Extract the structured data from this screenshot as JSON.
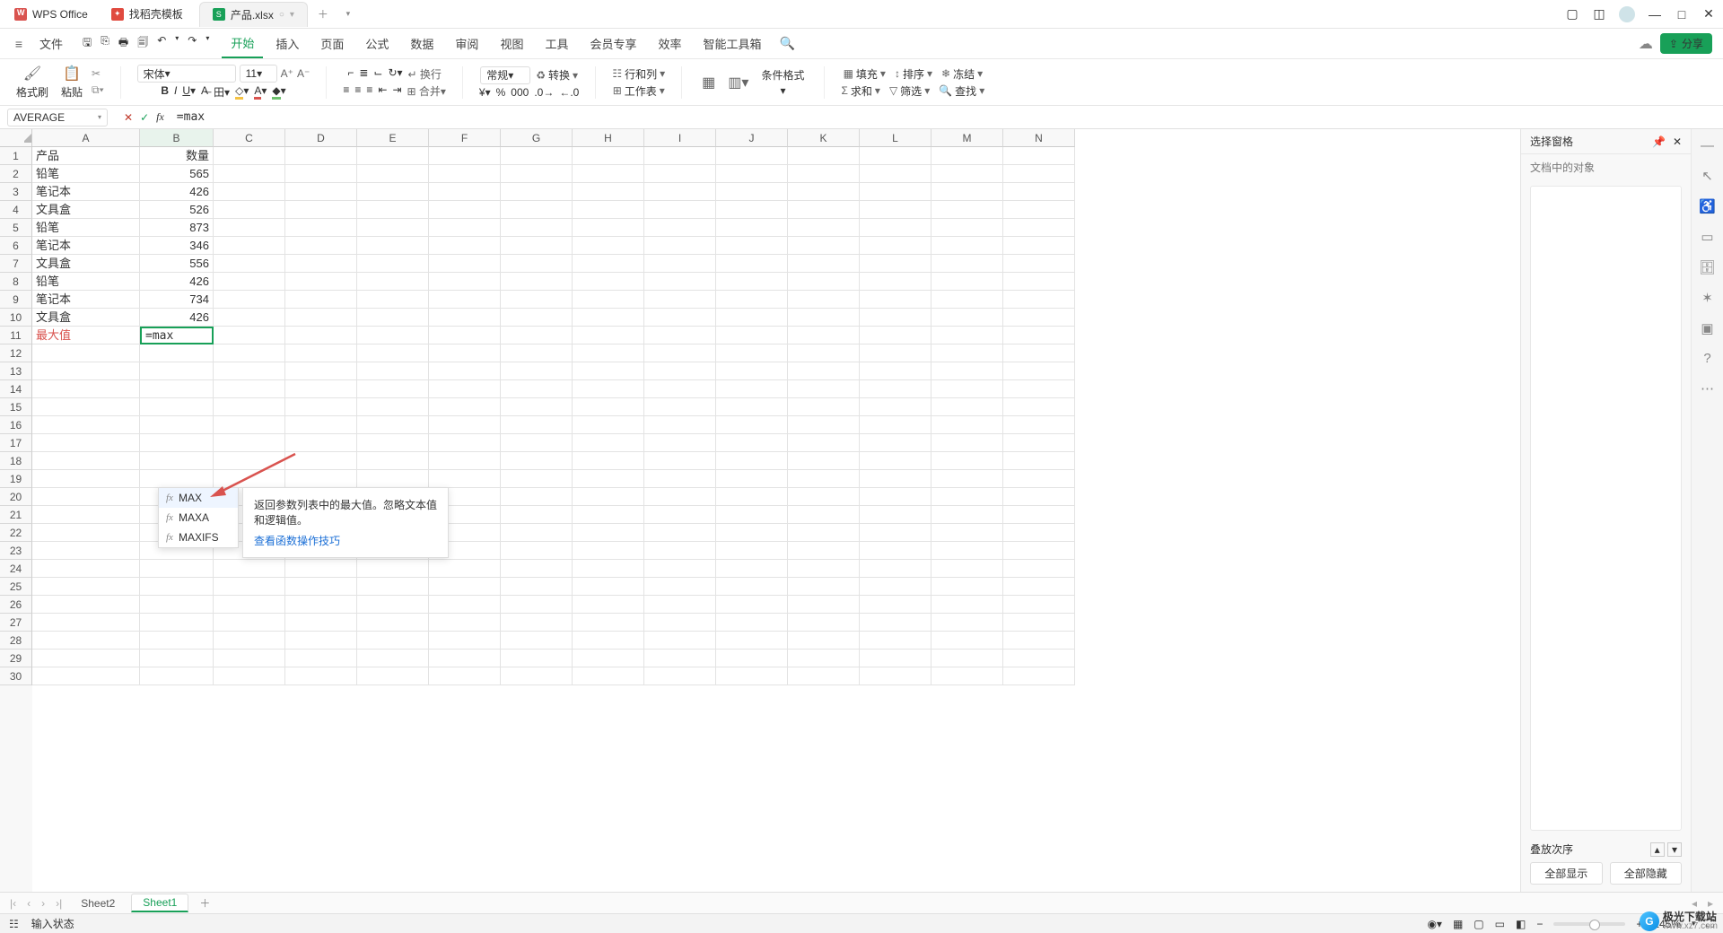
{
  "titlebar": {
    "app_name": "WPS Office",
    "tabs": [
      {
        "icon": "red",
        "label": "找稻壳模板"
      },
      {
        "icon": "green",
        "label": "产品.xlsx",
        "active": true
      }
    ]
  },
  "file_menu": "文件",
  "menu": {
    "items": [
      "开始",
      "插入",
      "页面",
      "公式",
      "数据",
      "审阅",
      "视图",
      "工具",
      "会员专享",
      "效率",
      "智能工具箱"
    ],
    "active": "开始",
    "share": "分享"
  },
  "ribbon": {
    "format_brush": "格式刷",
    "paste": "粘贴",
    "font_name": "宋体",
    "font_size": "11",
    "number_format": "常规",
    "convert": "转换",
    "rowcol": "行和列",
    "worksheet": "工作表",
    "cond_format": "条件格式",
    "fill": "填充",
    "sort": "排序",
    "freeze": "冻结",
    "sum": "求和",
    "filter": "筛选",
    "find": "查找"
  },
  "formula": {
    "namebox": "AVERAGE",
    "value": "=max"
  },
  "columns": [
    "A",
    "B",
    "C",
    "D",
    "E",
    "F",
    "G",
    "H",
    "I",
    "J",
    "K",
    "L",
    "M",
    "N"
  ],
  "sheet_data": {
    "header": {
      "a": "产品",
      "b": "数量"
    },
    "rows": [
      {
        "a": "铅笔",
        "b": "565"
      },
      {
        "a": "笔记本",
        "b": "426"
      },
      {
        "a": "文具盒",
        "b": "526"
      },
      {
        "a": "铅笔",
        "b": "873"
      },
      {
        "a": "笔记本",
        "b": "346"
      },
      {
        "a": "文具盒",
        "b": "556"
      },
      {
        "a": "铅笔",
        "b": "426"
      },
      {
        "a": "笔记本",
        "b": "734"
      },
      {
        "a": "文具盒",
        "b": "426"
      }
    ],
    "summary_label": "最大值",
    "editing_value": "=max"
  },
  "autocomplete": {
    "items": [
      "MAX",
      "MAXA",
      "MAXIFS"
    ],
    "tip_text": "返回参数列表中的最大值。忽略文本值和逻辑值。",
    "tip_link": "查看函数操作技巧"
  },
  "rightpanel": {
    "title": "选择窗格",
    "subtitle": "文档中的对象",
    "stack_label": "叠放次序",
    "show_all": "全部显示",
    "hide_all": "全部隐藏"
  },
  "sheets": {
    "tabs": [
      "Sheet2",
      "Sheet1"
    ],
    "active": "Sheet1"
  },
  "statusbar": {
    "mode": "输入状态",
    "zoom": "145%"
  },
  "watermark": {
    "text": "极光下载站",
    "url": "www.xz7.com"
  }
}
